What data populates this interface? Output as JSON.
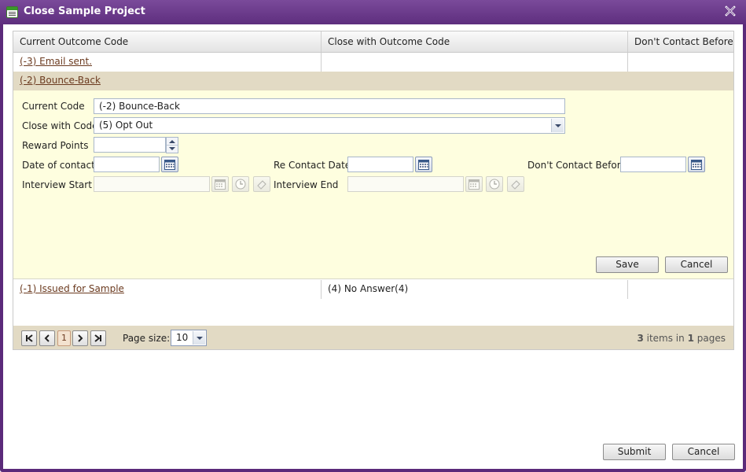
{
  "window": {
    "title": "Close Sample Project"
  },
  "grid": {
    "columns": [
      "Current Outcome Code",
      "Close with Outcome Code",
      "Don't Contact Before"
    ],
    "rows": [
      {
        "current": "(-3) Email sent.",
        "close_with": "",
        "dont_contact": ""
      },
      {
        "current": "(-2) Bounce-Back",
        "close_with": "",
        "dont_contact": ""
      },
      {
        "current": "(-1) Issued for Sample",
        "close_with": "(4) No Answer(4)",
        "dont_contact": ""
      }
    ]
  },
  "edit_form": {
    "current_code_label": "Current Code",
    "current_code_value": "(-2) Bounce-Back",
    "close_with_label": "Close with Code",
    "close_with_value": "(5) Opt Out",
    "reward_points_label": "Reward Points",
    "reward_points_value": "",
    "date_of_contact_label": "Date of contact",
    "re_contact_date_label": "Re Contact Date",
    "dont_contact_before_label": "Don't Contact Before",
    "interview_start_label": "Interview Start",
    "interview_end_label": "Interview End",
    "save_label": "Save",
    "cancel_label": "Cancel"
  },
  "pager": {
    "current_page": "1",
    "page_size_label": "Page size:",
    "page_size_value": "10",
    "items_count": "3",
    "items_text": "items in",
    "pages_count": "1",
    "pages_text": "pages"
  },
  "footer": {
    "submit_label": "Submit",
    "cancel_label": "Cancel"
  },
  "colors": {
    "titlebar": "#5e2e7e",
    "selected_row": "#e2dac4",
    "edit_form_bg": "#fefedf",
    "link": "#6b3a1f"
  },
  "icons": [
    "window-icon",
    "close-icon",
    "calendar-icon",
    "clock-icon",
    "clear-icon",
    "first-page-icon",
    "prev-page-icon",
    "next-page-icon",
    "last-page-icon",
    "spin-up-icon",
    "spin-down-icon",
    "dropdown-arrow-icon"
  ]
}
